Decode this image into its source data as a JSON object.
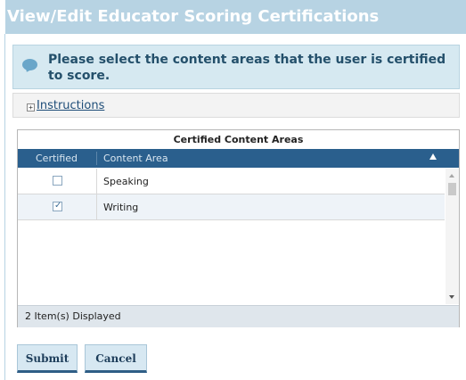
{
  "window": {
    "title": "View/Edit Educator Scoring Certifications"
  },
  "info": {
    "message": "Please select the content areas that the user is certified to score."
  },
  "instructions": {
    "expand_symbol": "+",
    "link_label": "Instructions"
  },
  "grid": {
    "caption": "Certified Content Areas",
    "columns": [
      "Certified",
      "Content Area"
    ],
    "rows": [
      {
        "certified": false,
        "content_area": "Speaking"
      },
      {
        "certified": true,
        "content_area": "Writing"
      }
    ],
    "footer": "2 Item(s) Displayed"
  },
  "buttons": {
    "submit": "Submit",
    "cancel": "Cancel"
  },
  "colors": {
    "header_bg": "#2a5f8d",
    "title_bg": "#b7d3e3",
    "info_bg": "#d6e9f1"
  }
}
